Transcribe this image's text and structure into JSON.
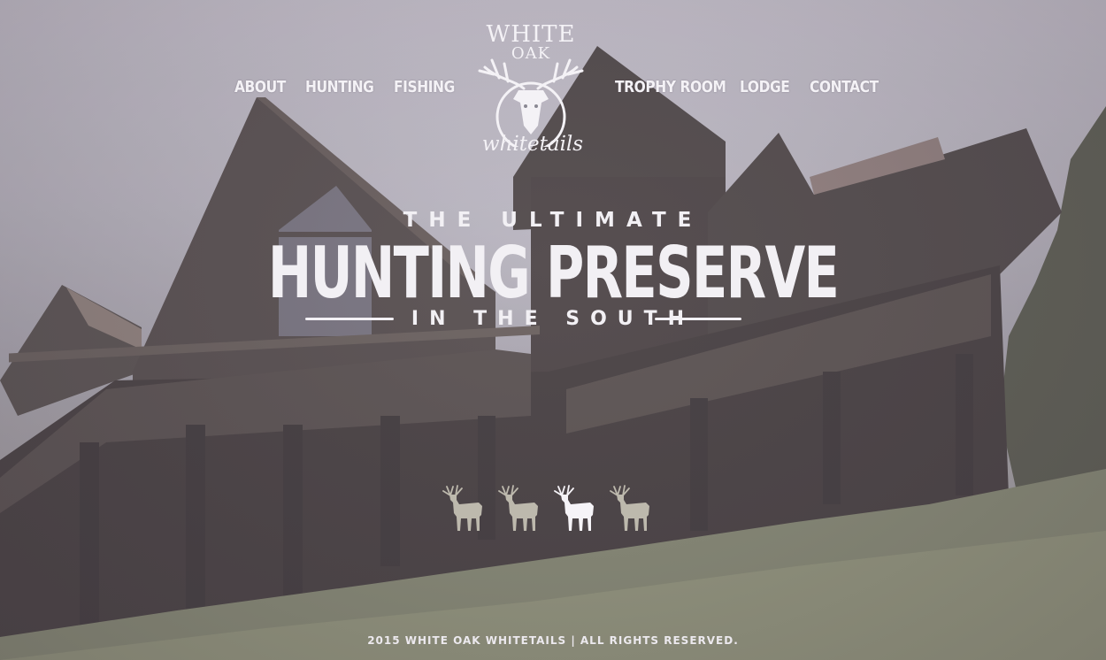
{
  "logo": {
    "line1": "WHITE",
    "line2": "OAK",
    "script": "whitetails"
  },
  "nav": {
    "about": "ABOUT",
    "hunting": "HUNTING",
    "fishing": "FISHING",
    "trophy_room": "TROPHY ROOM",
    "lodge": "LODGE",
    "contact": "CONTACT"
  },
  "hero": {
    "line1": "THE ULTIMATE",
    "line2": "HUNTING PRESERVE",
    "line3": "IN THE SOUTH"
  },
  "slider": {
    "count": 4,
    "active_index": 2,
    "active_color": "#f6f4f8",
    "inactive_color": "#bdb9ad"
  },
  "footer": {
    "copyright": "2015 WHITE OAK WHITETAILS | ALL RIGHTS RESERVED."
  }
}
